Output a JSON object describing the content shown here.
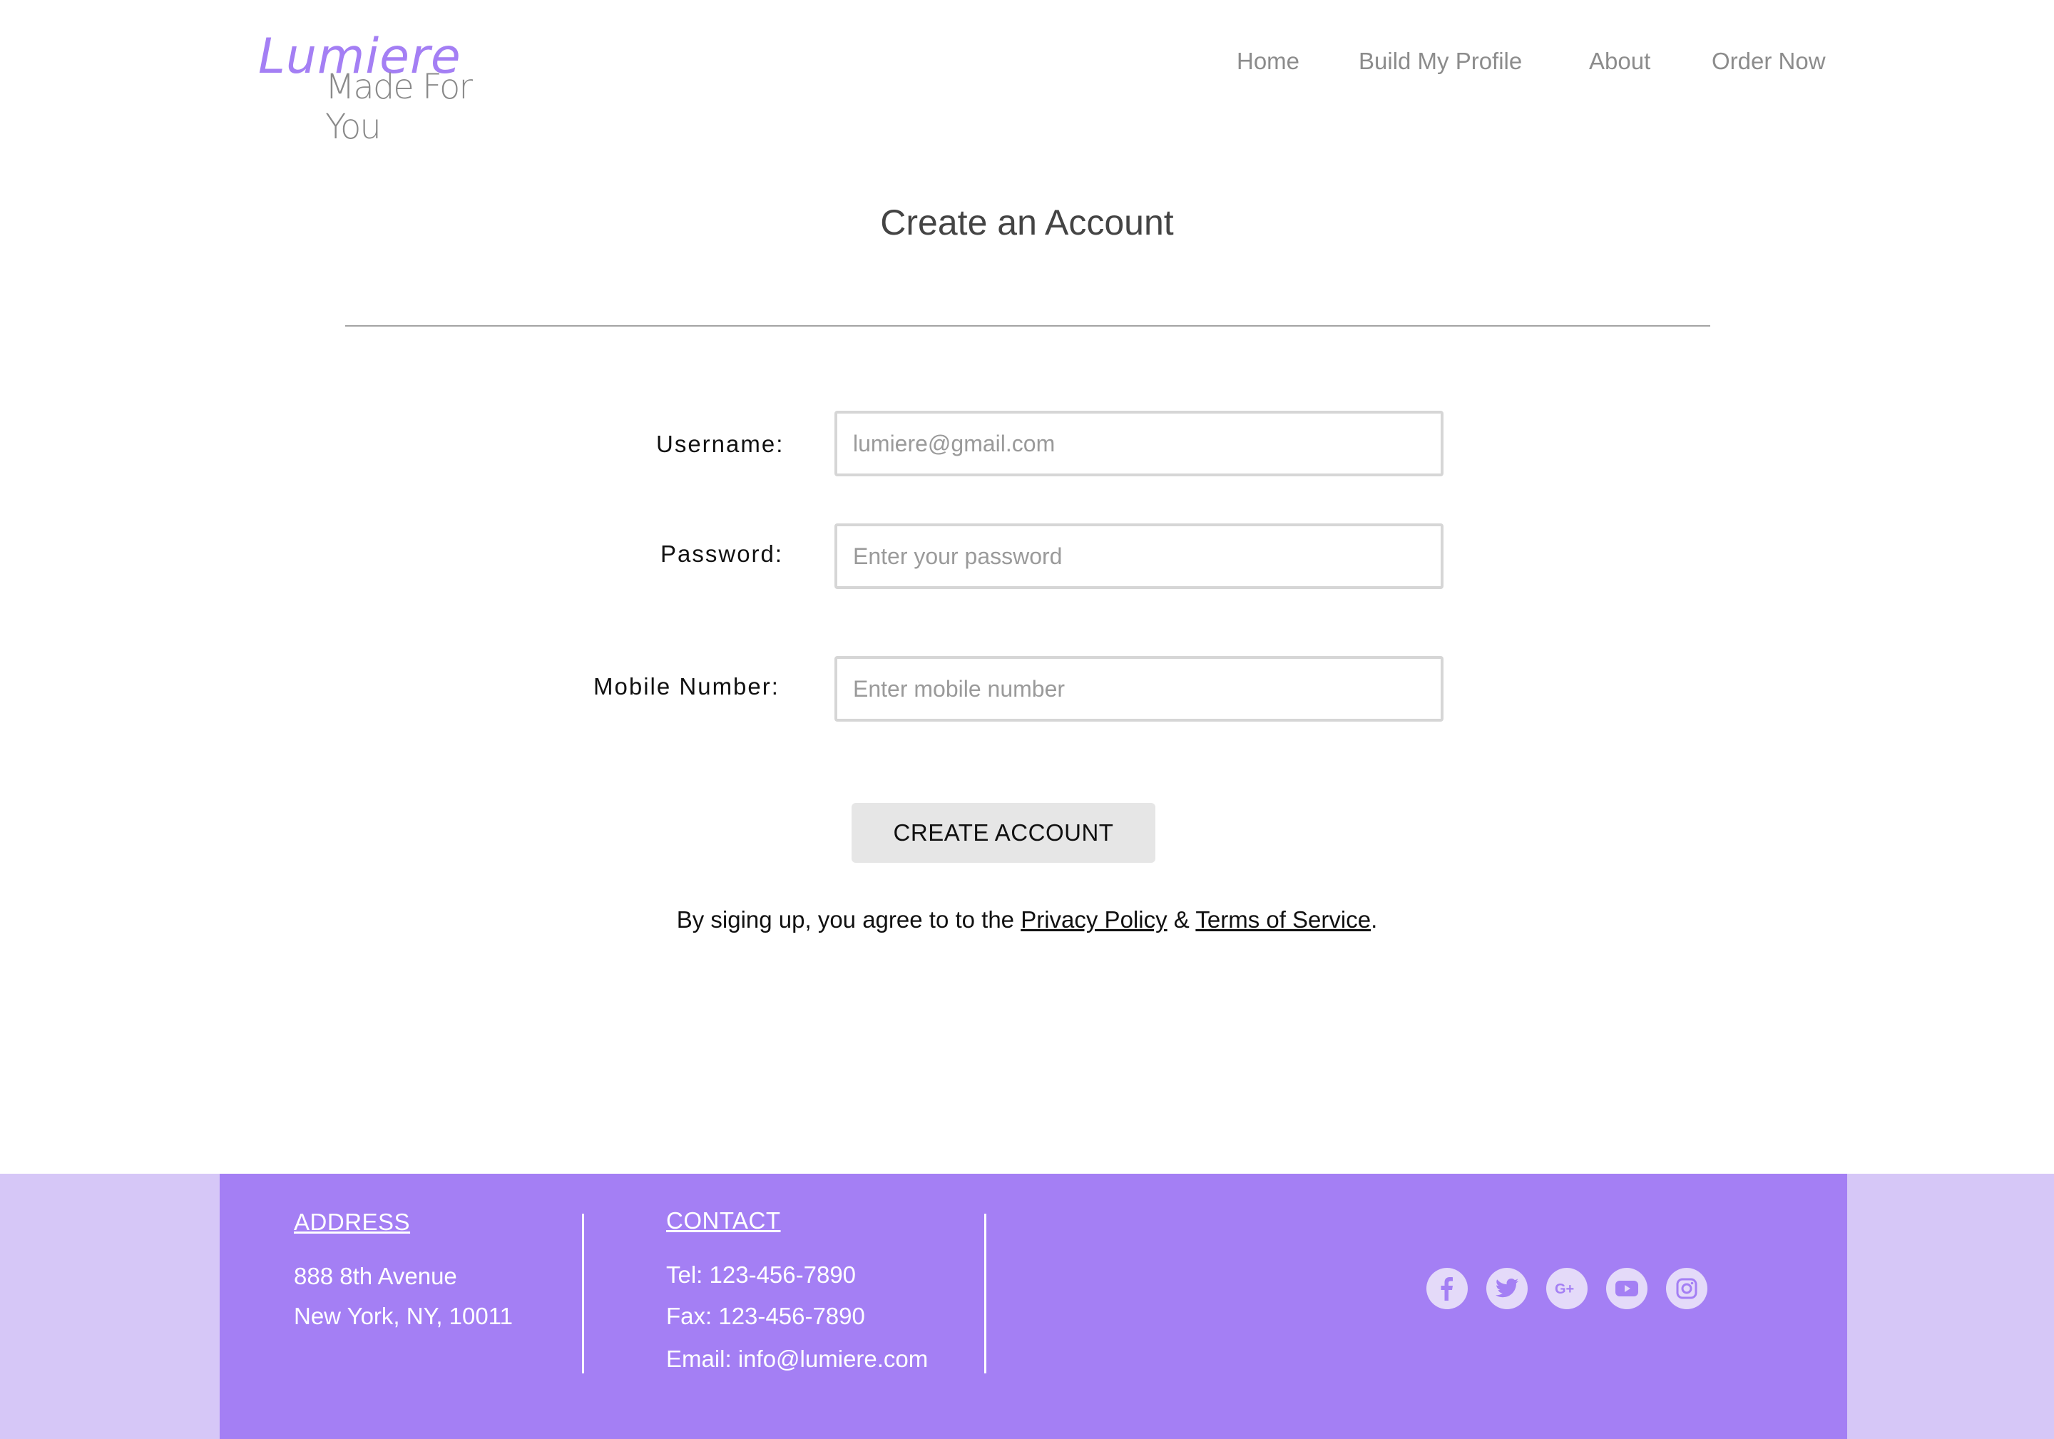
{
  "brand": {
    "name": "Lumiere",
    "tagline": "Made For You"
  },
  "nav": {
    "items": [
      {
        "label": "Home"
      },
      {
        "label": "Build My Profile"
      },
      {
        "label": "About"
      },
      {
        "label": "Order Now"
      }
    ]
  },
  "main": {
    "title": "Create an Account",
    "fields": {
      "username": {
        "label": "Username:",
        "placeholder": "lumiere@gmail.com",
        "value": ""
      },
      "password": {
        "label": "Password:",
        "placeholder": "Enter your password",
        "value": ""
      },
      "mobile": {
        "label": "Mobile Number:",
        "placeholder": "Enter mobile number",
        "value": ""
      }
    },
    "create_button": "CREATE ACCOUNT",
    "agreement": {
      "prefix": "By siging up, you agree to to the ",
      "privacy_link": "Privacy Policy",
      "middle": " & ",
      "terms_link": "Terms of Service",
      "suffix": "."
    }
  },
  "footer": {
    "address": {
      "heading": "ADDRESS",
      "line1": "888 8th Avenue",
      "line2": "New York, NY, 10011"
    },
    "contact": {
      "heading": "CONTACT",
      "tel": "Tel: 123-456-7890",
      "fax": "Fax: 123-456-7890",
      "email": "Email: info@lumiere.com"
    },
    "social_icons": [
      "facebook-icon",
      "twitter-icon",
      "google-plus-icon",
      "youtube-icon",
      "instagram-icon"
    ]
  },
  "colors": {
    "brand_purple": "#a47ff4",
    "footer_light": "#d6c7f7",
    "button_gray": "#e6e6e6",
    "nav_gray": "#8c8c8c"
  }
}
